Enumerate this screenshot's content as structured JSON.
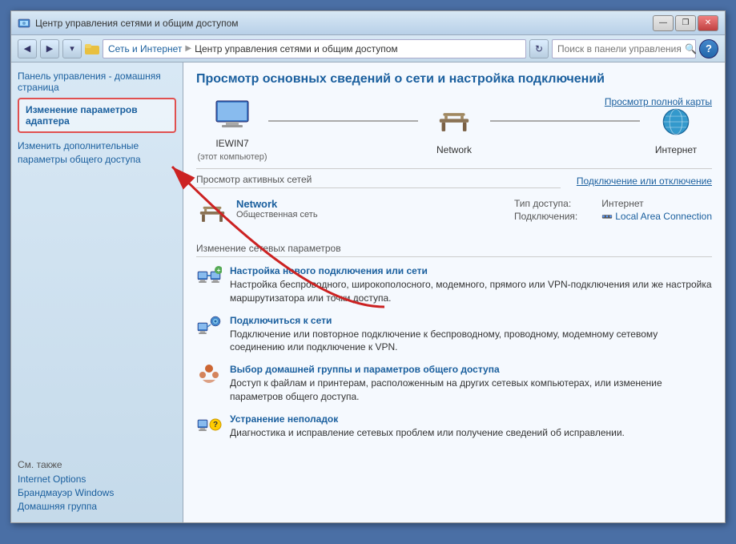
{
  "window": {
    "title": "Центр управления сетями и общим доступом",
    "titlebar_icon": "network-folder-icon"
  },
  "titlebar": {
    "minimize_label": "—",
    "restore_label": "❐",
    "close_label": "✕"
  },
  "addressbar": {
    "back_label": "◀",
    "forward_label": "▶",
    "dropdown_label": "▾",
    "refresh_label": "↻",
    "breadcrumb": {
      "part1": "Сеть и Интернет",
      "sep1": "▶",
      "part2": "Центр управления сетями и общим доступом"
    },
    "search_placeholder": "Поиск в панели управления",
    "search_icon": "🔍"
  },
  "toolbar": {
    "help_label": "?"
  },
  "sidebar": {
    "home_link": "Панель управления - домашняя страница",
    "adapter_link": "Изменение параметров адаптера",
    "advanced_link": "Изменить дополнительные параметры общего доступа",
    "also_title": "См. также",
    "also_links": [
      "Internet Options",
      "Брандмауэр Windows",
      "Домашняя группа"
    ]
  },
  "main": {
    "title": "Просмотр основных сведений о сети и настройка подключений",
    "view_full_map": "Просмотр полной карты",
    "network_nodes": [
      {
        "id": "computer",
        "label": "IEWIN7",
        "sublabel": "(этот компьютер)"
      },
      {
        "id": "network",
        "label": "Network",
        "sublabel": ""
      },
      {
        "id": "internet",
        "label": "Интернет",
        "sublabel": ""
      }
    ],
    "active_networks": {
      "title": "Просмотр активных сетей",
      "connect_label": "Подключение или отключение",
      "network_name": "Network",
      "network_type": "Общественная сеть",
      "access_type_label": "Тип доступа:",
      "access_type_value": "Интернет",
      "connections_label": "Подключения:",
      "connections_value": "Local Area Connection"
    },
    "change_settings": {
      "title": "Изменение сетевых параметров",
      "actions": [
        {
          "id": "new-connection",
          "link": "Настройка нового подключения или сети",
          "desc": "Настройка беспроводного, широкополосного, модемного, прямого или VPN-подключения или же настройка маршрутизатора или точки доступа."
        },
        {
          "id": "connect-network",
          "link": "Подключиться к сети",
          "desc": "Подключение или повторное подключение к беспроводному, проводному, модемному сетевому соединению или подключение к VPN."
        },
        {
          "id": "homegroup",
          "link": "Выбор домашней группы и параметров общего доступа",
          "desc": "Доступ к файлам и принтерам, расположенным на других сетевых компьютерах, или изменение параметров общего доступа."
        },
        {
          "id": "troubleshoot",
          "link": "Устранение неполадок",
          "desc": "Диагностика и исправление сетевых проблем или получение сведений об исправлении."
        }
      ]
    }
  },
  "colors": {
    "accent_blue": "#1a5f9e",
    "sidebar_bg": "#d8e8f5",
    "main_bg": "#f5f9fe",
    "border": "#9ab",
    "red_border": "#e05050"
  }
}
